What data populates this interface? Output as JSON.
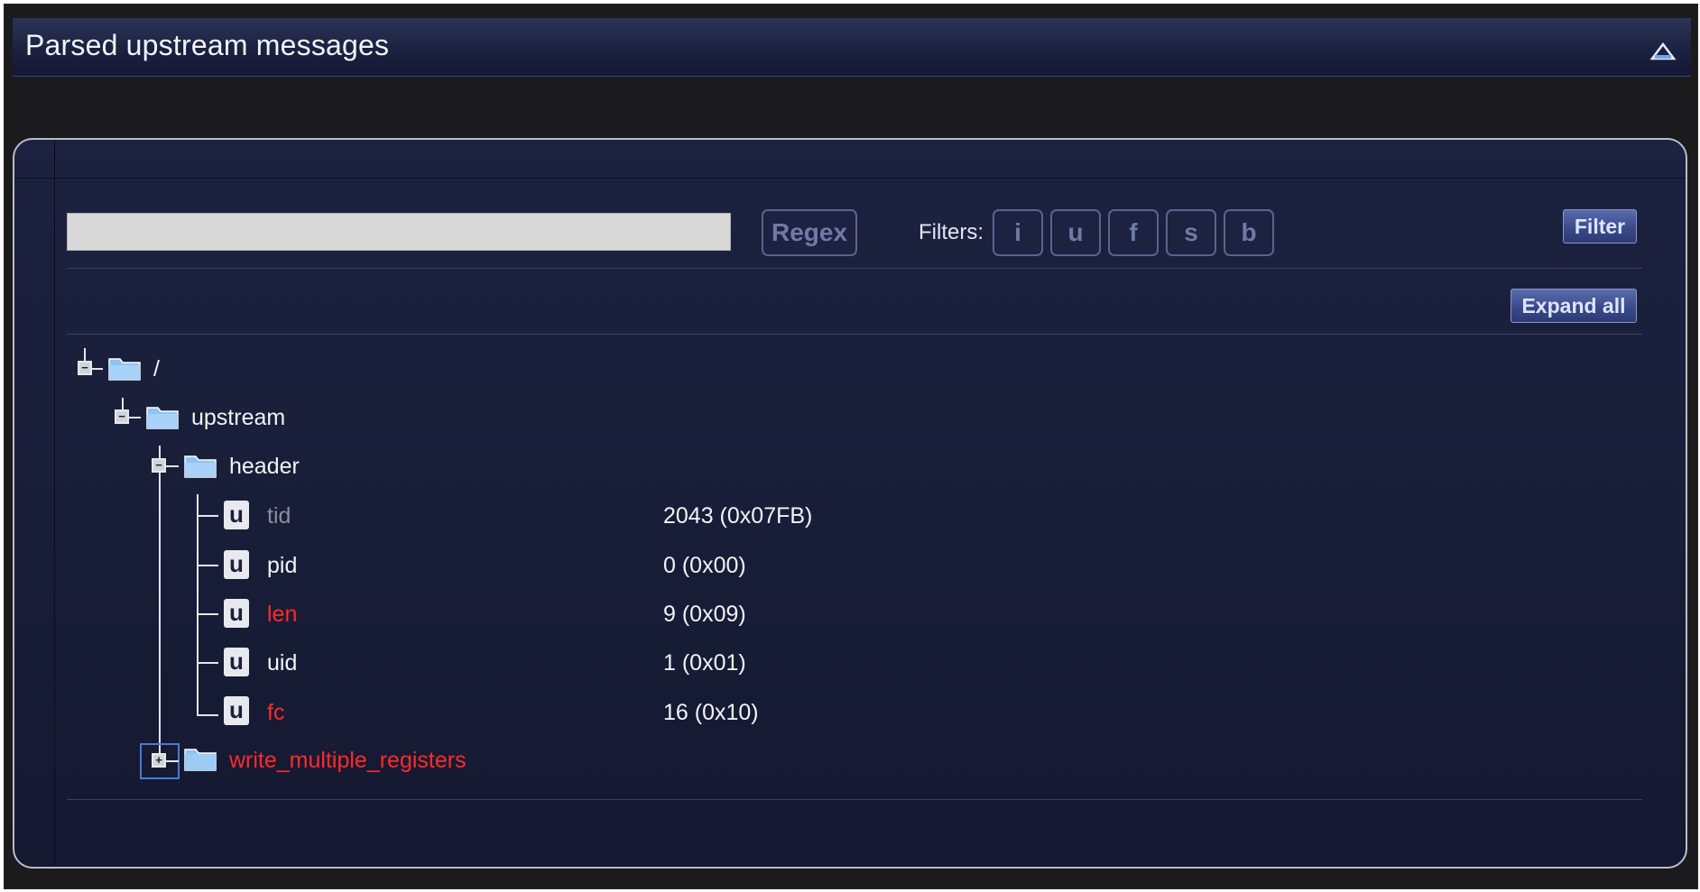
{
  "panel": {
    "title": "Parsed upstream messages"
  },
  "toolbar": {
    "search_value": "",
    "regex_label": "Regex",
    "filters_label": "Filters:",
    "filter_buttons": [
      "i",
      "u",
      "f",
      "s",
      "b"
    ],
    "filter_label": "Filter",
    "expand_all_label": "Expand all"
  },
  "tree": {
    "root": {
      "label": "/"
    },
    "upstream": {
      "label": "upstream"
    },
    "header": {
      "label": "header"
    },
    "fields": [
      {
        "icon": "u",
        "label": "tid",
        "value": "2043 (0x07FB)",
        "color": "#8b8d98"
      },
      {
        "icon": "u",
        "label": "pid",
        "value": "0 (0x00)",
        "color": "#f2f3f8"
      },
      {
        "icon": "u",
        "label": "len",
        "value": "9 (0x09)",
        "color": "#ff2a2a"
      },
      {
        "icon": "u",
        "label": "uid",
        "value": "1 (0x01)",
        "color": "#f2f3f8"
      },
      {
        "icon": "u",
        "label": "fc",
        "value": "16 (0x10)",
        "color": "#ff2a2a"
      }
    ],
    "write_multiple": {
      "label": "write_multiple_registers"
    }
  },
  "colors": {
    "error_red": "#ff2a2a",
    "disabled_gray": "#8b8d98",
    "panel_bg": "#1c223f",
    "folder_blue": "#8fc3f2"
  }
}
